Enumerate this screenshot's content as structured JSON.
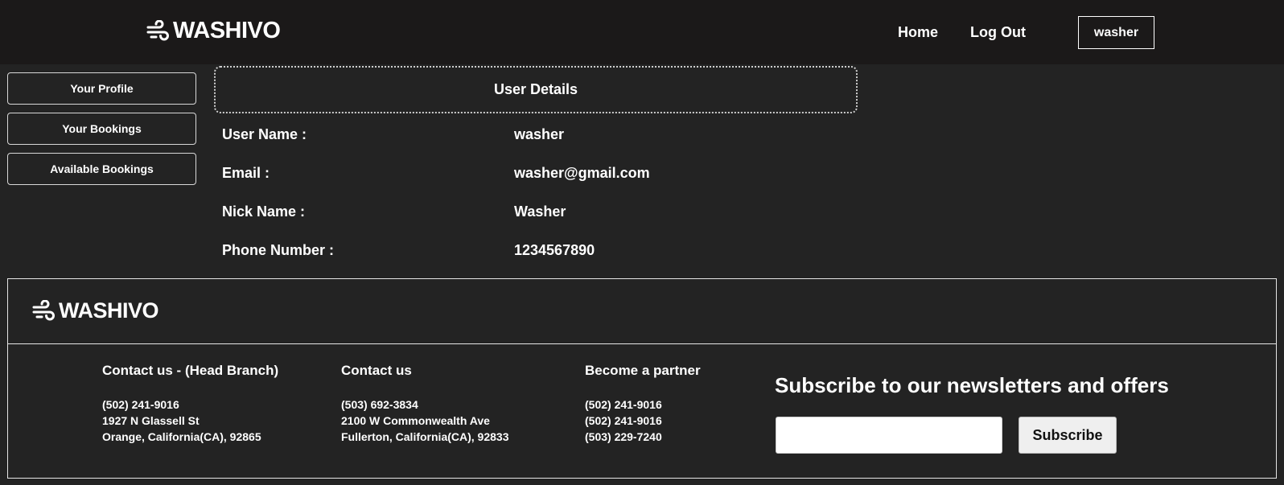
{
  "brand": {
    "name": "WASHIVO",
    "icon": "wind-icon"
  },
  "nav": {
    "home": "Home",
    "logout": "Log Out",
    "user": "washer"
  },
  "sidebar": {
    "items": [
      {
        "label": "Your Profile"
      },
      {
        "label": "Your Bookings"
      },
      {
        "label": "Available Bookings"
      }
    ]
  },
  "details": {
    "title": "User Details",
    "rows": [
      {
        "label": "User Name :",
        "value": "washer"
      },
      {
        "label": "Email :",
        "value": "washer@gmail.com"
      },
      {
        "label": "Nick Name :",
        "value": "Washer"
      },
      {
        "label": "Phone Number :",
        "value": "1234567890"
      }
    ]
  },
  "footer": {
    "brand": "WASHIVO",
    "columns": [
      {
        "title": "Contact us - (Head Branch)",
        "lines": [
          "(502) 241-9016",
          "1927 N Glassell St",
          "Orange, California(CA), 92865"
        ]
      },
      {
        "title": "Contact us",
        "lines": [
          "(503) 692-3834",
          "2100 W Commonwealth Ave",
          "Fullerton, California(CA), 92833"
        ]
      },
      {
        "title": "Become a partner",
        "lines": [
          "(502) 241-9016",
          "(502) 241-9016",
          "(503) 229-7240"
        ]
      }
    ],
    "newsletter": {
      "title": "Subscribe to our newsletters and offers",
      "input_value": "",
      "button": "Subscribe"
    }
  }
}
